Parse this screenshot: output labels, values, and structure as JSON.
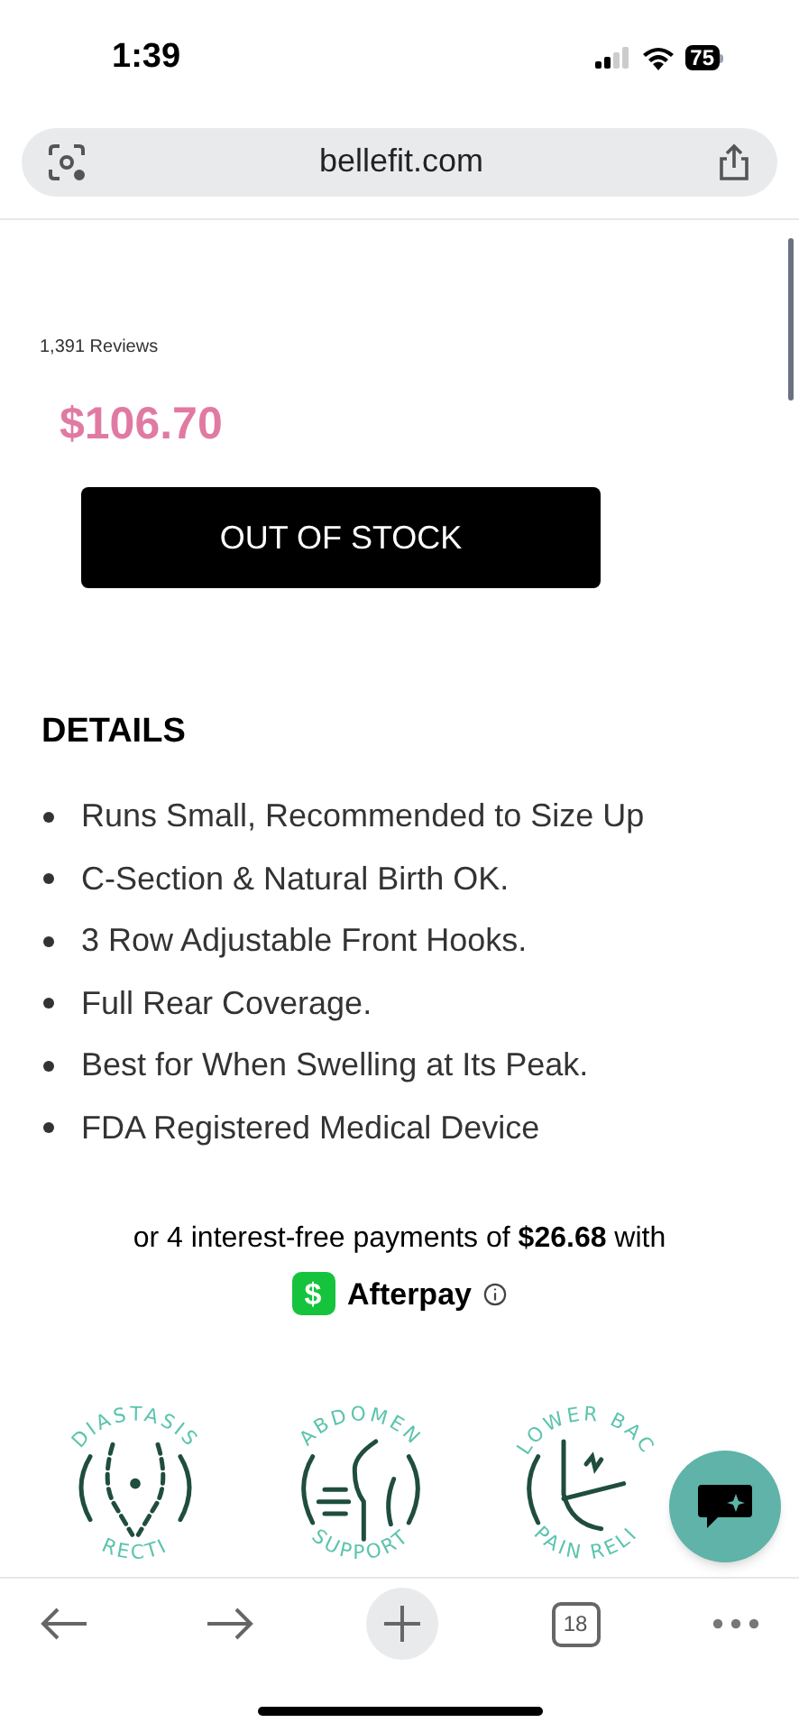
{
  "status_bar": {
    "time": "1:39",
    "battery": "75"
  },
  "address_bar": {
    "url": "bellefit.com"
  },
  "product": {
    "reviews": "1,391 Reviews",
    "price": "$106.70",
    "button": "OUT OF STOCK",
    "button_disabled": true
  },
  "details": {
    "title": "DETAILS",
    "items": [
      "Runs Small, Recommended to Size Up",
      "C-Section & Natural Birth OK.",
      "3 Row Adjustable Front Hooks.",
      "Full Rear Coverage.",
      "Best for When Swelling at Its Peak.",
      "FDA Registered Medical Device"
    ]
  },
  "afterpay": {
    "text": "or 4 interest-free payments of **$26.68** with",
    "brand_icon": "$",
    "brand": "Afterpay"
  },
  "badges": [
    {
      "kind": "diastasis",
      "top": "DIASTASIS",
      "bottom": "RECTI"
    },
    {
      "kind": "abdomen",
      "top": "ABDOMEN",
      "bottom": "SUPPORT"
    },
    {
      "kind": "back",
      "top": "LOWER BAC",
      "bottom": "PAIN RELI"
    }
  ],
  "toolbar": {
    "tabs_count": "18"
  }
}
